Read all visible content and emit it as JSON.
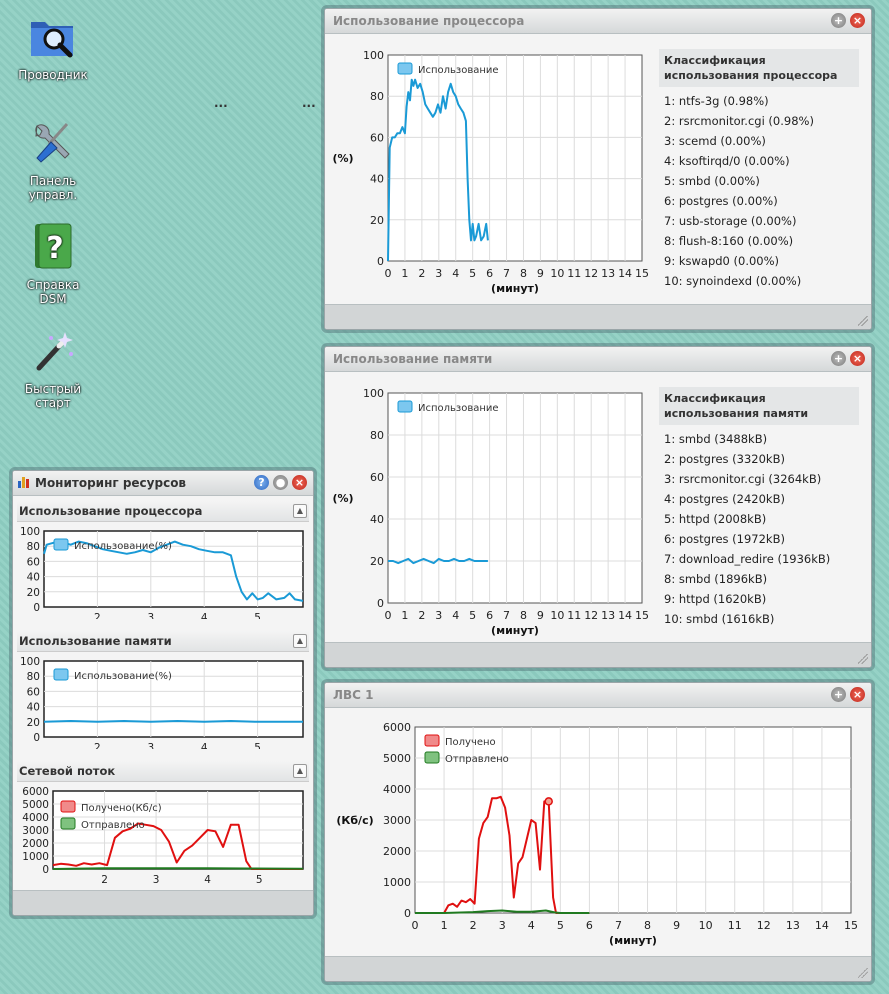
{
  "desktop": {
    "icons": [
      {
        "label": "Проводник"
      },
      {
        "label": "Панель\nуправл."
      },
      {
        "label": "Справка\nDSM"
      },
      {
        "label": "Быстрый\nстарт"
      }
    ],
    "dots": "..."
  },
  "cpu_window": {
    "title": "Использование процессора",
    "ranking_title": "Классификация использования процессора",
    "ranking": [
      "1: ntfs-3g (0.98%)",
      "2: rsrcmonitor.cgi (0.98%)",
      "3: scemd (0.00%)",
      "4: ksoftirqd/0 (0.00%)",
      "5: smbd (0.00%)",
      "6: postgres (0.00%)",
      "7: usb-storage (0.00%)",
      "8: flush-8:160 (0.00%)",
      "9: kswapd0 (0.00%)",
      "10: synoindexd (0.00%)"
    ]
  },
  "mem_window": {
    "title": "Использование памяти",
    "ranking_title": "Классификация использования памяти",
    "ranking": [
      "1: smbd (3488kB)",
      "2: postgres (3320kB)",
      "3: rsrcmonitor.cgi (3264kB)",
      "4: postgres (2420kB)",
      "5: httpd (2008kB)",
      "6: postgres (1972kB)",
      "7: download_redire (1936kB)",
      "8: smbd (1896kB)",
      "9: httpd (1620kB)",
      "10: smbd (1616kB)"
    ]
  },
  "lan_window": {
    "title": "ЛВС 1"
  },
  "monitor_window": {
    "title": "Мониторинг ресурсов",
    "sections": {
      "cpu": "Использование процессора",
      "mem": "Использование памяти",
      "net": "Сетевой поток"
    }
  },
  "colors": {
    "usage": "#1a9ad6",
    "received": "#e01010",
    "sent": "#207a20"
  },
  "chart_data": [
    {
      "id": "cpu_large",
      "type": "line",
      "ylabel": "(%)",
      "xlabel": "(минут)",
      "xlim": [
        0,
        15
      ],
      "ylim": [
        0,
        100
      ],
      "xticks": [
        0,
        1,
        2,
        3,
        4,
        5,
        6,
        7,
        8,
        9,
        10,
        11,
        12,
        13,
        14,
        15
      ],
      "yticks": [
        0,
        20,
        40,
        60,
        80,
        100
      ],
      "series": [
        {
          "name": "Использование",
          "color": "#1a9ad6",
          "x": [
            0,
            0.1,
            0.25,
            0.4,
            0.55,
            0.7,
            0.85,
            1.0,
            1.1,
            1.2,
            1.3,
            1.4,
            1.5,
            1.6,
            1.75,
            1.9,
            2.05,
            2.2,
            2.35,
            2.5,
            2.65,
            2.8,
            2.95,
            3.1,
            3.25,
            3.4,
            3.55,
            3.7,
            3.85,
            4.0,
            4.15,
            4.3,
            4.45,
            4.6,
            4.7,
            4.8,
            4.9,
            5.0,
            5.1,
            5.2,
            5.35,
            5.5,
            5.65,
            5.8,
            5.9
          ],
          "y": [
            0,
            55,
            60,
            60,
            62,
            62,
            65,
            62,
            75,
            82,
            78,
            88,
            85,
            88,
            84,
            86,
            82,
            76,
            74,
            72,
            70,
            72,
            76,
            72,
            80,
            74,
            82,
            86,
            82,
            80,
            76,
            74,
            72,
            68,
            40,
            20,
            10,
            18,
            10,
            12,
            18,
            10,
            12,
            18,
            10
          ]
        }
      ]
    },
    {
      "id": "mem_large",
      "type": "line",
      "ylabel": "(%)",
      "xlabel": "(минут)",
      "xlim": [
        0,
        15
      ],
      "ylim": [
        0,
        100
      ],
      "xticks": [
        0,
        1,
        2,
        3,
        4,
        5,
        6,
        7,
        8,
        9,
        10,
        11,
        12,
        13,
        14,
        15
      ],
      "yticks": [
        0,
        20,
        40,
        60,
        80,
        100
      ],
      "series": [
        {
          "name": "Использование",
          "color": "#1a9ad6",
          "x": [
            0,
            0.3,
            0.6,
            0.9,
            1.2,
            1.5,
            1.8,
            2.1,
            2.4,
            2.7,
            3.0,
            3.3,
            3.6,
            3.9,
            4.2,
            4.5,
            4.8,
            5.1,
            5.4,
            5.7,
            5.9
          ],
          "y": [
            20,
            20,
            19,
            20,
            21,
            19,
            20,
            21,
            20,
            19,
            21,
            20,
            20,
            21,
            20,
            20,
            21,
            20,
            20,
            20,
            20
          ]
        }
      ]
    },
    {
      "id": "lan_large",
      "type": "line",
      "ylabel": "(Кб/с)",
      "xlabel": "(минут)",
      "xlim": [
        0,
        15
      ],
      "ylim": [
        0,
        6000
      ],
      "xticks": [
        0,
        1,
        2,
        3,
        4,
        5,
        6,
        7,
        8,
        9,
        10,
        11,
        12,
        13,
        14,
        15
      ],
      "yticks": [
        0,
        1000,
        2000,
        3000,
        4000,
        5000,
        6000
      ],
      "series": [
        {
          "name": "Получено",
          "color": "#e01010",
          "x": [
            0,
            0.5,
            1.0,
            1.15,
            1.3,
            1.45,
            1.6,
            1.75,
            1.9,
            2.05,
            2.2,
            2.35,
            2.5,
            2.65,
            2.8,
            2.95,
            3.1,
            3.25,
            3.4,
            3.55,
            3.7,
            3.85,
            4.0,
            4.15,
            4.3,
            4.45,
            4.6,
            4.75,
            4.85,
            5.0,
            5.2,
            6.0
          ],
          "y": [
            0,
            0,
            0,
            250,
            300,
            200,
            400,
            350,
            450,
            300,
            2400,
            2900,
            3100,
            3700,
            3700,
            3750,
            3400,
            2500,
            500,
            1600,
            1800,
            2400,
            3000,
            2900,
            1400,
            3600,
            3600,
            500,
            0,
            0,
            0,
            0
          ]
        },
        {
          "name": "Отправлено",
          "color": "#207a20",
          "x": [
            0,
            1.0,
            2.0,
            2.5,
            3.0,
            3.5,
            4.0,
            4.5,
            4.8,
            5.0,
            6.0
          ],
          "y": [
            0,
            0,
            30,
            60,
            80,
            40,
            40,
            80,
            20,
            0,
            0
          ]
        }
      ]
    },
    {
      "id": "cpu_mini",
      "type": "line",
      "legend": "Использование(%)",
      "xlim": [
        1.0,
        5.85
      ],
      "ylim": [
        0,
        100
      ],
      "xticks": [
        2,
        3,
        4,
        5
      ],
      "yticks": [
        0,
        20,
        40,
        60,
        80,
        100
      ],
      "series": [
        {
          "name": "Использование(%)",
          "color": "#1a9ad6",
          "x": [
            1.0,
            1.05,
            1.2,
            1.35,
            1.5,
            1.65,
            1.8,
            1.95,
            2.1,
            2.25,
            2.4,
            2.55,
            2.7,
            2.85,
            3.0,
            3.15,
            3.3,
            3.45,
            3.6,
            3.75,
            3.9,
            4.05,
            4.2,
            4.35,
            4.5,
            4.6,
            4.7,
            4.8,
            4.9,
            5.0,
            5.1,
            5.2,
            5.35,
            5.5,
            5.6,
            5.7,
            5.85
          ],
          "y": [
            70,
            82,
            85,
            85,
            82,
            86,
            84,
            80,
            76,
            74,
            72,
            70,
            72,
            75,
            72,
            78,
            82,
            86,
            82,
            80,
            76,
            74,
            72,
            72,
            68,
            40,
            20,
            10,
            18,
            10,
            12,
            18,
            10,
            12,
            18,
            10,
            8
          ]
        }
      ]
    },
    {
      "id": "mem_mini",
      "type": "line",
      "legend": "Использование(%)",
      "xlim": [
        1.0,
        5.85
      ],
      "ylim": [
        0,
        100
      ],
      "xticks": [
        2,
        3,
        4,
        5
      ],
      "yticks": [
        0,
        20,
        40,
        60,
        80,
        100
      ],
      "series": [
        {
          "name": "Использование(%)",
          "color": "#1a9ad6",
          "x": [
            1.0,
            1.5,
            2.0,
            2.5,
            3.0,
            3.5,
            4.0,
            4.5,
            5.0,
            5.5,
            5.85
          ],
          "y": [
            20,
            21,
            20,
            21,
            20,
            21,
            20,
            21,
            20,
            20,
            20
          ]
        }
      ]
    },
    {
      "id": "net_mini",
      "type": "line",
      "legend": [
        "Получено(Кб/с)",
        "Отправлено"
      ],
      "xlim": [
        1.0,
        5.85
      ],
      "ylim": [
        0,
        6000
      ],
      "xticks": [
        2,
        3,
        4,
        5
      ],
      "yticks": [
        0,
        1000,
        2000,
        3000,
        4000,
        5000,
        6000
      ],
      "series": [
        {
          "name": "Получено(Кб/с)",
          "color": "#e01010",
          "x": [
            1.0,
            1.15,
            1.3,
            1.45,
            1.6,
            1.75,
            1.9,
            2.05,
            2.2,
            2.35,
            2.5,
            2.65,
            2.8,
            2.95,
            3.1,
            3.25,
            3.4,
            3.55,
            3.7,
            3.85,
            4.0,
            4.15,
            4.3,
            4.45,
            4.6,
            4.75,
            4.85,
            5.0,
            5.85
          ],
          "y": [
            300,
            400,
            350,
            250,
            450,
            350,
            450,
            300,
            2400,
            2900,
            3100,
            3500,
            3400,
            3300,
            3000,
            2100,
            500,
            1400,
            1800,
            2400,
            3000,
            2900,
            1700,
            3400,
            3400,
            600,
            0,
            0,
            0
          ]
        },
        {
          "name": "Отправлено",
          "color": "#207a20",
          "x": [
            1.0,
            2.0,
            3.0,
            4.0,
            4.8,
            5.85
          ],
          "y": [
            0,
            50,
            60,
            50,
            40,
            20
          ]
        }
      ]
    }
  ]
}
